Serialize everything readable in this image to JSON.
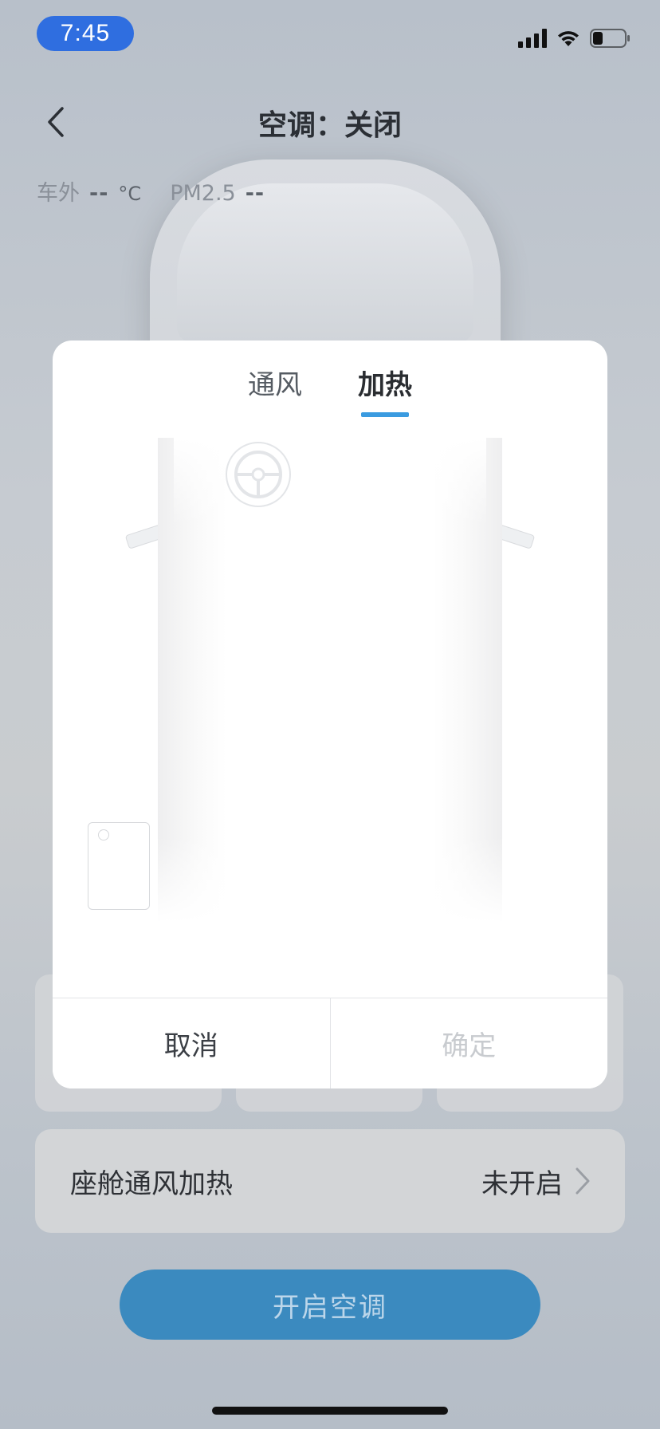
{
  "status_bar": {
    "time": "7:45"
  },
  "header": {
    "title": "空调：关闭"
  },
  "environment": {
    "outside_label": "车外",
    "outside_value": "--",
    "outside_unit": "°C",
    "pm_label": "PM2.5",
    "pm_value": "--"
  },
  "modal": {
    "tabs": [
      {
        "label": "通风",
        "active": false
      },
      {
        "label": "加热",
        "active": true
      }
    ],
    "cancel_label": "取消",
    "confirm_label": "确定",
    "accent_color": "#3a9be0"
  },
  "feature_row": {
    "label": "座舱通风加热",
    "status": "未开启"
  },
  "primary_action": {
    "label": "开启空调",
    "color": "#3b8abf"
  }
}
